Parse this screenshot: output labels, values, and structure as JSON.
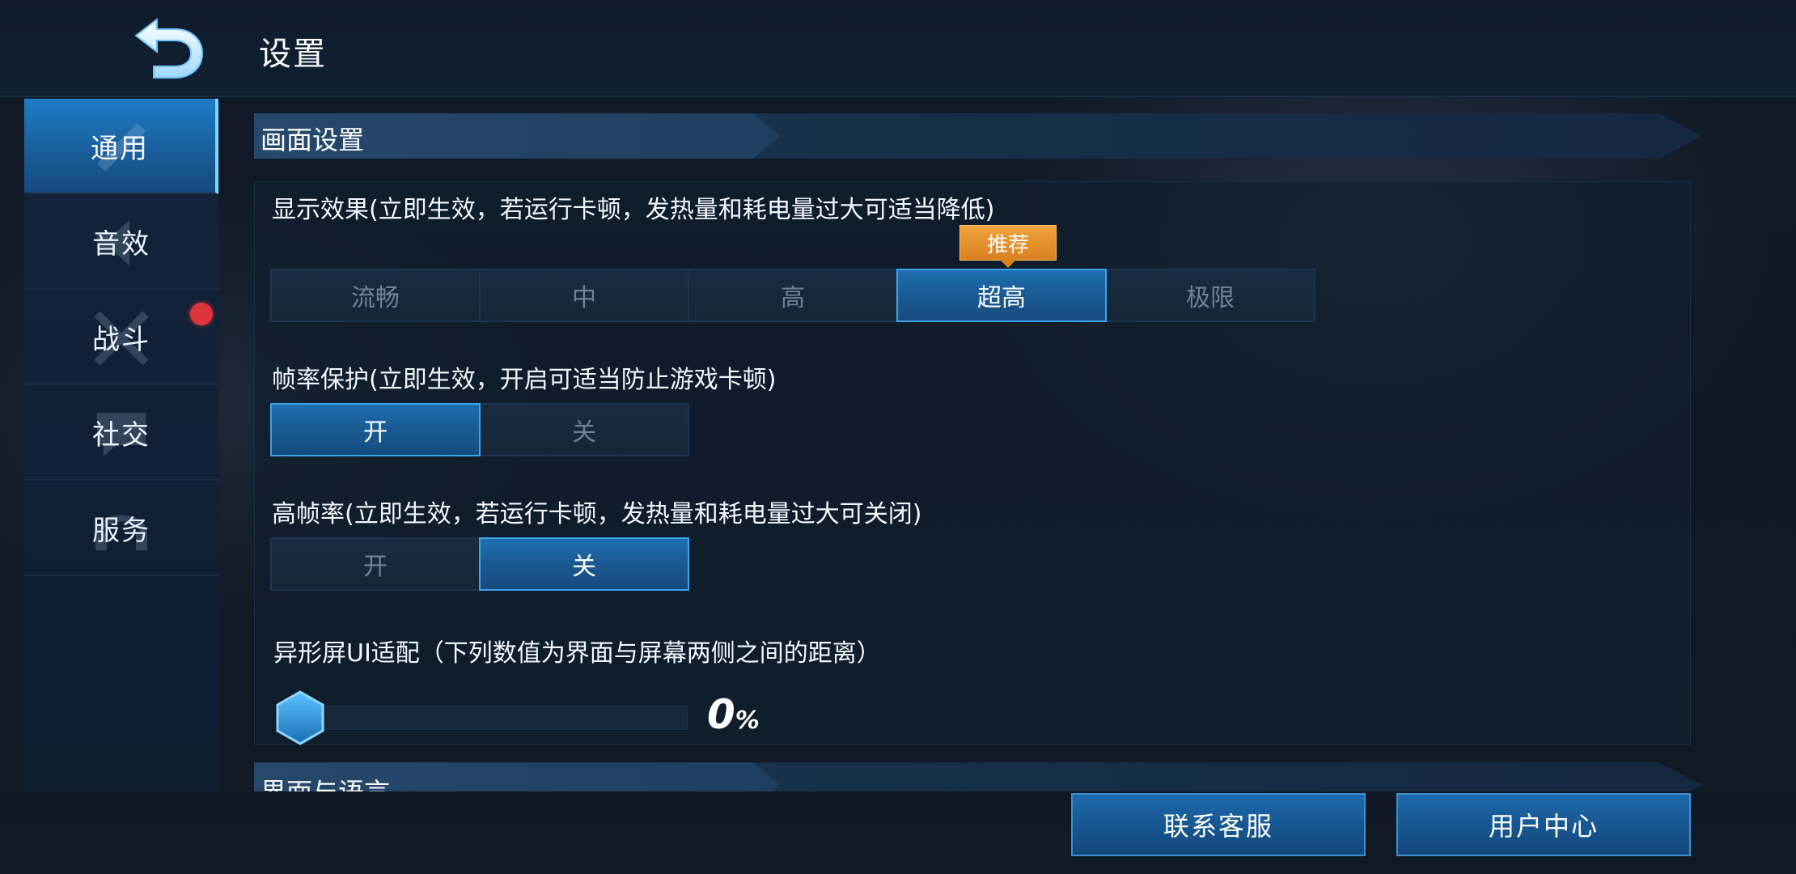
{
  "header": {
    "title": "设置",
    "back_icon": "back-arrow-icon"
  },
  "sidebar": {
    "items": [
      {
        "label": "通用",
        "active": true
      },
      {
        "label": "音效",
        "active": false
      },
      {
        "label": "战斗",
        "active": false,
        "notification": true
      },
      {
        "label": "社交",
        "active": false
      },
      {
        "label": "服务",
        "active": false
      }
    ]
  },
  "sections": {
    "display": {
      "title": "画面设置"
    },
    "interface": {
      "title": "界面与语言"
    }
  },
  "settings": {
    "quality": {
      "label": "显示效果(立即生效，若运行卡顿，发热量和耗电量过大可适当降低)",
      "options": [
        "流畅",
        "中",
        "高",
        "超高",
        "极限"
      ],
      "selected": "超高",
      "badge": "推荐"
    },
    "frame_protect": {
      "label": "帧率保护(立即生效，开启可适当防止游戏卡顿)",
      "options": [
        "开",
        "关"
      ],
      "selected": "开"
    },
    "high_fps": {
      "label": "高帧率(立即生效，若运行卡顿，发热量和耗电量过大可关闭)",
      "options": [
        "开",
        "关"
      ],
      "selected": "关"
    },
    "notch_adapt": {
      "label": "异形屏UI适配（下列数值为界面与屏幕两侧之间的距离）",
      "value": "0",
      "unit": "%",
      "level": 0
    }
  },
  "buttons": {
    "contact": "联系客服",
    "user_center": "用户中心"
  },
  "colors": {
    "accent": "#1f6fb0",
    "accent_border": "#3ea4ea",
    "badge": "#e8922c",
    "dot": "#e0343c"
  }
}
